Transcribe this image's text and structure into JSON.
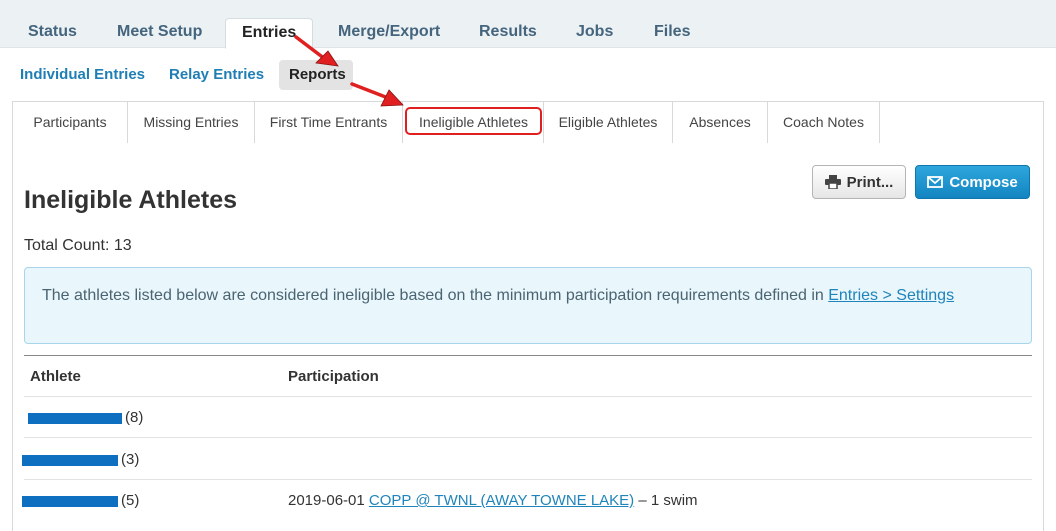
{
  "top_tabs": {
    "status": "Status",
    "meet_setup": "Meet Setup",
    "entries": "Entries",
    "merge_export": "Merge/Export",
    "results": "Results",
    "jobs": "Jobs",
    "files": "Files"
  },
  "sub_nav": {
    "individual": "Individual Entries",
    "relay": "Relay Entries",
    "reports": "Reports"
  },
  "report_tabs": {
    "participants": "Participants",
    "missing": "Missing Entries",
    "first_time": "First Time Entrants",
    "ineligible": "Ineligible Athletes",
    "eligible": "Eligible Athletes",
    "absences": "Absences",
    "coach_notes": "Coach Notes"
  },
  "buttons": {
    "print": "Print...",
    "compose": "Compose"
  },
  "page": {
    "title": "Ineligible Athletes",
    "total_count": "Total Count: 13",
    "info_text": "The athletes listed below are considered ineligible based on the minimum participation requirements defined in ",
    "info_link": "Entries > Settings"
  },
  "table": {
    "headers": {
      "athlete": "Athlete",
      "participation": "Participation"
    },
    "rows": [
      {
        "count": "(8)",
        "participation_date": "",
        "participation_link": "",
        "participation_suffix": ""
      },
      {
        "count": "(3)",
        "participation_date": "",
        "participation_link": "",
        "participation_suffix": ""
      },
      {
        "count": "(5)",
        "participation_date": "2019-06-01 ",
        "participation_link": "COPP @ TWNL (AWAY TOWNE LAKE)",
        "participation_suffix": " – 1 swim"
      }
    ]
  },
  "colors": {
    "accent": "#1f7fb5",
    "annotation": "#e02020",
    "redaction": "#0e6ec0"
  }
}
